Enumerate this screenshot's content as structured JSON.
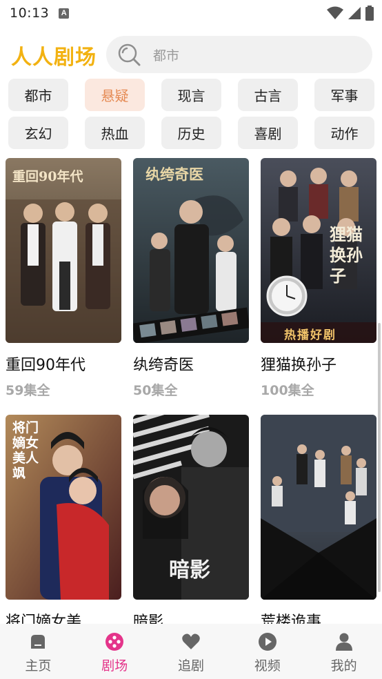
{
  "status_bar": {
    "time": "10:13",
    "notification_letter": "A"
  },
  "header": {
    "app_title": "人人剧场",
    "search_placeholder": "都市"
  },
  "categories": [
    {
      "label": "都市",
      "active": false
    },
    {
      "label": "悬疑",
      "active": true
    },
    {
      "label": "现言",
      "active": false
    },
    {
      "label": "古言",
      "active": false
    },
    {
      "label": "军事",
      "active": false
    },
    {
      "label": "玄幻",
      "active": false
    },
    {
      "label": "热血",
      "active": false
    },
    {
      "label": "历史",
      "active": false
    },
    {
      "label": "喜剧",
      "active": false
    },
    {
      "label": "动作",
      "active": false
    }
  ],
  "dramas": [
    {
      "title": "重回90年代",
      "episodes": "59集全",
      "poster_text": "重回90年代",
      "poster_color": "#6b5a4a"
    },
    {
      "title": "纨绔奇医",
      "episodes": "50集全",
      "poster_text": "纨绔奇医",
      "poster_color": "#3a4650"
    },
    {
      "title": "狸猫换孙子",
      "episodes": "100集全",
      "poster_text": "狸猫换孙子",
      "poster_sub": "热播好剧",
      "poster_color": "#2c2f3a"
    },
    {
      "title": "将门嫡女美",
      "episodes": "",
      "poster_text": "将门嫡女美人飒",
      "poster_color": "#8c2a2a"
    },
    {
      "title": "暗影",
      "episodes": "",
      "poster_text": "暗影",
      "poster_color": "#1d1d1d"
    },
    {
      "title": "荒楼诡事",
      "episodes": "",
      "poster_text": "",
      "poster_color": "#2a3340"
    }
  ],
  "bottom_nav": [
    {
      "label": "主页",
      "icon": "home-icon",
      "active": false
    },
    {
      "label": "剧场",
      "icon": "theater-icon",
      "active": true
    },
    {
      "label": "追剧",
      "icon": "heart-icon",
      "active": false
    },
    {
      "label": "视频",
      "icon": "play-icon",
      "active": false
    },
    {
      "label": "我的",
      "icon": "profile-icon",
      "active": false
    }
  ],
  "colors": {
    "brand": "#f2b212",
    "active_tab": "#e4348a",
    "active_chip_bg": "#fbe8df",
    "active_chip_text": "#e58a53"
  }
}
